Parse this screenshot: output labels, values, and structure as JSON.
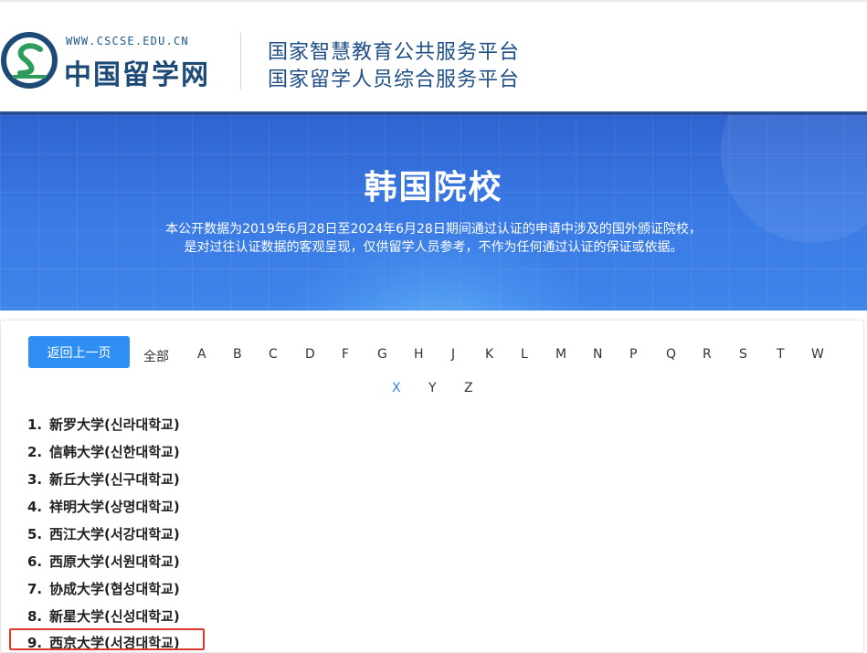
{
  "header": {
    "logo_url": "WWW.CSCSE.EDU.CN",
    "logo_name": "中国留学网",
    "platform_line1": "国家智慧教育公共服务平台",
    "platform_line2": "国家留学人员综合服务平台"
  },
  "banner": {
    "title": "韩国院校",
    "desc_line1": "本公开数据为2019年6月28日至2024年6月28日期间通过认证的申请中涉及的国外颁证院校，",
    "desc_line2": "是对过往认证数据的客观呈现，仅供留学人员参考，不作为任何通过认证的保证或依据。"
  },
  "nav": {
    "back_label": "返回上一页",
    "all_label": "全部",
    "letters": [
      "A",
      "B",
      "C",
      "D",
      "F",
      "G",
      "H",
      "J",
      "K",
      "L",
      "M",
      "N",
      "P",
      "Q",
      "R",
      "S",
      "T",
      "W",
      "X",
      "Y",
      "Z"
    ],
    "active_letter": "X"
  },
  "schools": [
    {
      "num": "1.",
      "name": "新罗大学(신라대학교)"
    },
    {
      "num": "2.",
      "name": "信韩大学(신한대학교)"
    },
    {
      "num": "3.",
      "name": "新丘大学(신구대학교)"
    },
    {
      "num": "4.",
      "name": "祥明大学(상명대학교)"
    },
    {
      "num": "5.",
      "name": "西江大学(서강대학교)"
    },
    {
      "num": "6.",
      "name": "西原大学(서원대학교)"
    },
    {
      "num": "7.",
      "name": "协成大学(협성대학교)"
    },
    {
      "num": "8.",
      "name": "新星大学(신성대학교)"
    },
    {
      "num": "9.",
      "name": "西京大学(서경대학교)"
    }
  ],
  "colors": {
    "accent": "#2f8ef2",
    "active_letter": "#3a86d6",
    "highlight_box": "#e0362a",
    "banner_blue": "#3a79e4"
  }
}
